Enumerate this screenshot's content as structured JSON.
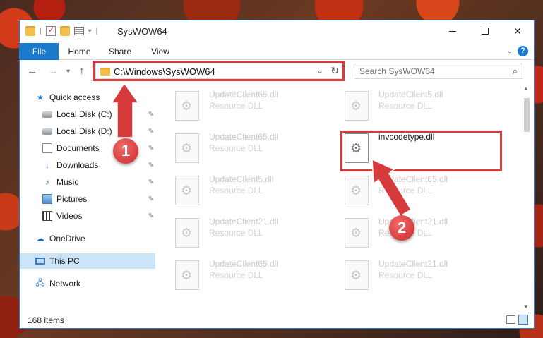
{
  "window": {
    "title": "SysWOW64",
    "colors": {
      "accent": "#1979ca",
      "highlight": "#d63b3b",
      "selection": "#cce4f7"
    }
  },
  "ribbon": {
    "tabs": [
      "File",
      "Home",
      "Share",
      "View"
    ],
    "help_label": "?"
  },
  "navbar": {
    "address": "C:\\Windows\\SysWOW64",
    "search_placeholder": "Search SysWOW64"
  },
  "sidebar": {
    "items": [
      {
        "label": "Quick access",
        "icon": "star-icon"
      },
      {
        "label": "Local Disk (C:)",
        "icon": "drive-icon",
        "pinned": true
      },
      {
        "label": "Local Disk (D:)",
        "icon": "drive-icon",
        "pinned": true
      },
      {
        "label": "Documents",
        "icon": "document-icon",
        "pinned": true
      },
      {
        "label": "Downloads",
        "icon": "download-icon",
        "pinned": true
      },
      {
        "label": "Music",
        "icon": "music-icon",
        "pinned": true
      },
      {
        "label": "Pictures",
        "icon": "picture-icon",
        "pinned": true
      },
      {
        "label": "Videos",
        "icon": "video-icon",
        "pinned": true
      },
      {
        "label": "OneDrive",
        "icon": "cloud-icon"
      },
      {
        "label": "This PC",
        "icon": "computer-icon",
        "selected": true
      },
      {
        "label": "Network",
        "icon": "network-icon"
      }
    ]
  },
  "files": [
    {
      "name": "UpdateClient65.dll",
      "type": "Resource DLL"
    },
    {
      "name": "UpdateClient5.dll",
      "type": "Resource DLL"
    },
    {
      "name": "UpdateClient65.dll",
      "type": "Resource DLL"
    },
    {
      "name": "invcodetype.dll",
      "type": ""
    },
    {
      "name": "UpdateClient5.dll",
      "type": "Resource DLL"
    },
    {
      "name": "UpdateClient65.dll",
      "type": "Resource DLL"
    },
    {
      "name": "UpdateClient21.dll",
      "type": "Resource DLL"
    },
    {
      "name": "UpdateClient21.dll",
      "type": "Resource DLL"
    },
    {
      "name": "UpdateClient65.dll",
      "type": "Resource DLL"
    },
    {
      "name": "UpdateClient21.dll",
      "type": "Resource DLL"
    }
  ],
  "status": {
    "item_count": "168 items"
  },
  "annotations": {
    "badge1": "1",
    "badge2": "2"
  }
}
